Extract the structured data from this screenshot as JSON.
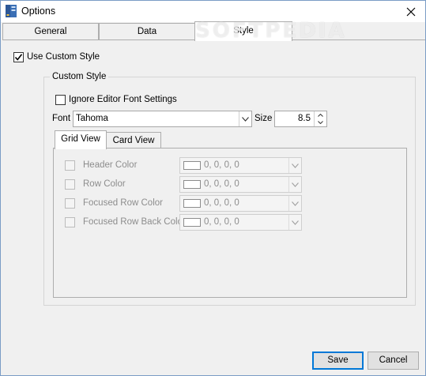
{
  "window": {
    "title": "Options"
  },
  "watermark": "SOFTPEDIA",
  "tabs": [
    {
      "label": "General",
      "active": false
    },
    {
      "label": "Data",
      "active": false
    },
    {
      "label": "Style",
      "active": true
    }
  ],
  "use_custom_style": {
    "label": "Use Custom Style",
    "checked": true
  },
  "custom_style": {
    "title": "Custom Style",
    "ignore_editor_font": {
      "label": "Ignore Editor Font Settings",
      "checked": false
    },
    "font_label": "Font",
    "font_value": "Tahoma",
    "size_label": "Size",
    "size_value": "8.5",
    "tabs": [
      {
        "label": "Grid View",
        "active": true
      },
      {
        "label": "Card View",
        "active": false
      }
    ],
    "color_rows": [
      {
        "label": "Header Color",
        "value": "0, 0, 0, 0",
        "checked": false
      },
      {
        "label": "Row Color",
        "value": "0, 0, 0, 0",
        "checked": false
      },
      {
        "label": "Focused Row Color",
        "value": "0, 0, 0, 0",
        "checked": false
      },
      {
        "label": "Focused Row Back Color",
        "value": "0, 0, 0, 0",
        "checked": false
      }
    ]
  },
  "buttons": {
    "save": "Save",
    "cancel": "Cancel"
  },
  "colors": {
    "accent": "#0078d7",
    "disabled_text": "#8d8d8d",
    "border": "#adadad"
  }
}
